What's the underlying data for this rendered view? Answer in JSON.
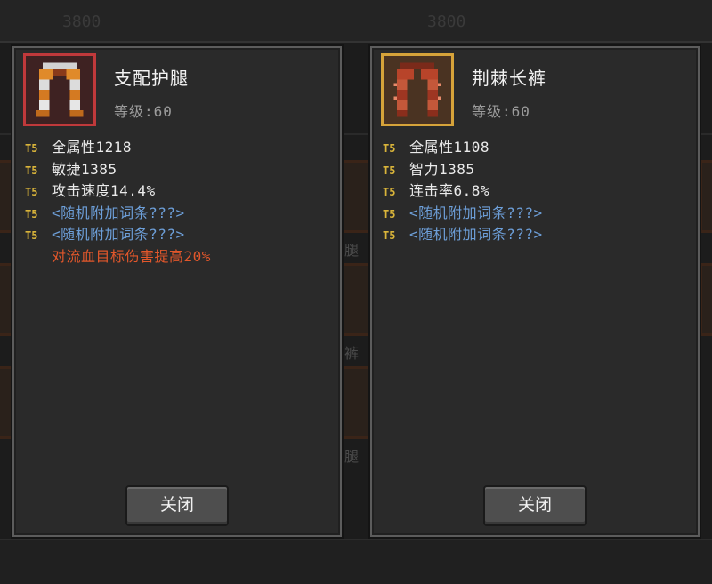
{
  "background": {
    "coin_left": "3800",
    "coin_right": "3800",
    "slot_label_1": "腿",
    "slot_label_2": "裤",
    "slot_label_3": "腿"
  },
  "colors": {
    "tier": "#d9b43a",
    "random_affix": "#6d9fd9",
    "special_affix": "#e2572b",
    "left_thumb_border": "#c0393b",
    "right_thumb_border": "#d6a33a"
  },
  "panels": [
    {
      "name": "支配护腿",
      "level": "等级:60",
      "thumb_icon": "leg-armor-icon",
      "stats": [
        {
          "tier": "T5",
          "text": "全属性1218",
          "type": "normal"
        },
        {
          "tier": "T5",
          "text": "敏捷1385",
          "type": "normal"
        },
        {
          "tier": "T5",
          "text": "攻击速度14.4%",
          "type": "normal"
        },
        {
          "tier": "T5",
          "text": "<随机附加词条???>",
          "type": "random"
        },
        {
          "tier": "T5",
          "text": "<随机附加词条???>",
          "type": "random"
        },
        {
          "tier": "",
          "text": "对流血目标伤害提高20%",
          "type": "special"
        }
      ],
      "close_label": "关闭"
    },
    {
      "name": "荆棘长裤",
      "level": "等级:60",
      "thumb_icon": "thorn-pants-icon",
      "stats": [
        {
          "tier": "T5",
          "text": "全属性1108",
          "type": "normal"
        },
        {
          "tier": "T5",
          "text": "智力1385",
          "type": "normal"
        },
        {
          "tier": "T5",
          "text": "连击率6.8%",
          "type": "normal"
        },
        {
          "tier": "T5",
          "text": "<随机附加词条???>",
          "type": "random"
        },
        {
          "tier": "T5",
          "text": "<随机附加词条???>",
          "type": "random"
        }
      ],
      "close_label": "关闭"
    }
  ]
}
